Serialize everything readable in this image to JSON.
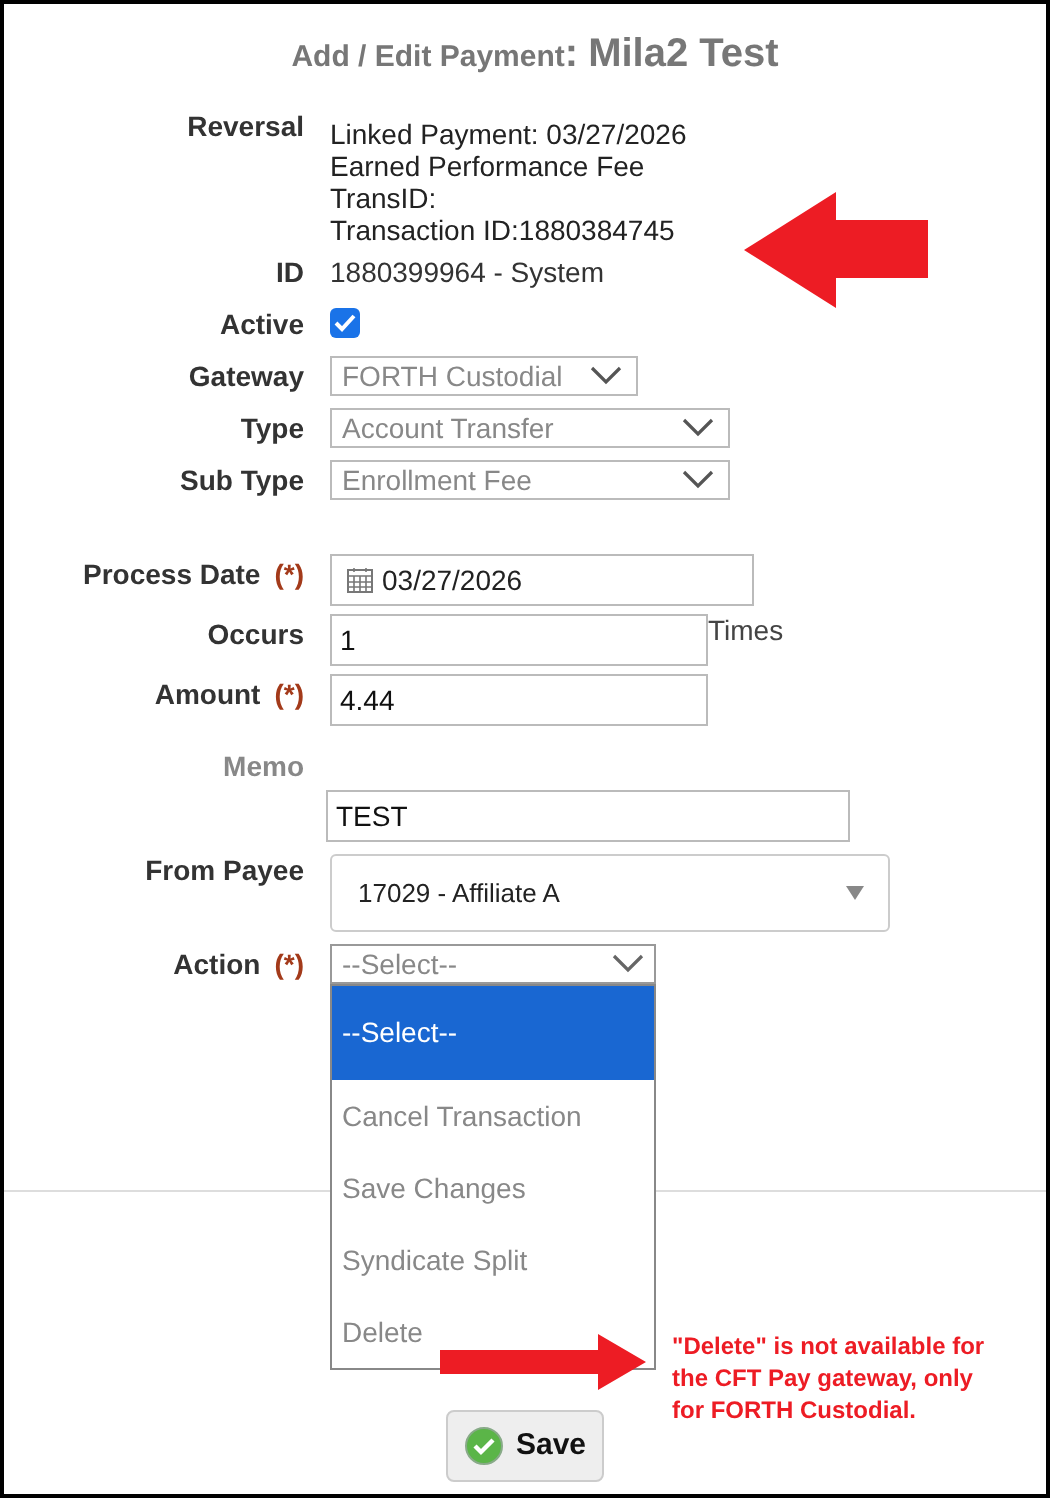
{
  "title": {
    "prefix": "Add / Edit Payment",
    "separator": ":",
    "name": "Mila2 Test"
  },
  "reversal": {
    "label": "Reversal",
    "lines": [
      "Linked Payment: 03/27/2026",
      "Earned Performance Fee",
      "TransID:",
      "Transaction ID:1880384745"
    ]
  },
  "fields": [
    {
      "kind": "text",
      "label": "ID",
      "value": "1880399964 - System"
    },
    {
      "kind": "checkbox",
      "label": "Active",
      "checked": true
    },
    {
      "kind": "select",
      "label": "Gateway",
      "value": "FORTH Custodial",
      "disabled": true
    },
    {
      "kind": "select",
      "label": "Type",
      "value": "Account Transfer",
      "disabled": true
    },
    {
      "kind": "select",
      "label": "Sub Type",
      "value": "Enrollment Fee",
      "disabled": true
    }
  ],
  "fields2": [
    {
      "kind": "date",
      "label": "Process Date",
      "required": "(*)",
      "value": "03/27/2026"
    },
    {
      "kind": "input",
      "label": "Occurs",
      "value": "1",
      "suffix": "Times"
    },
    {
      "kind": "input",
      "label": "Amount",
      "required": "(*)",
      "value": "4.44"
    },
    {
      "kind": "memo",
      "label": "Memo",
      "value": "TEST"
    },
    {
      "kind": "combo",
      "label": "From Payee",
      "value": "17029 - Affiliate A"
    }
  ],
  "action": {
    "label": "Action",
    "required": "(*)",
    "value": "--Select--",
    "expanded": true,
    "options": [
      {
        "label": "--Select--",
        "selected": true
      },
      {
        "label": "Cancel Transaction",
        "selected": false
      },
      {
        "label": "Save Changes",
        "selected": false
      },
      {
        "label": "Syndicate Split",
        "selected": false
      },
      {
        "label": "Delete",
        "selected": false
      }
    ]
  },
  "annotation": {
    "note": "\"Delete\" is not available for the CFT Pay gateway, only for FORTH Custodial."
  },
  "save_button": "Save"
}
